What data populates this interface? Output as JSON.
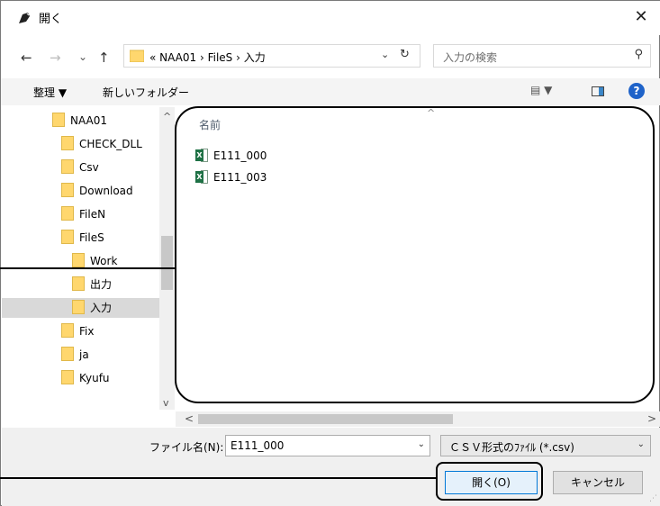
{
  "window": {
    "title": "開く",
    "close_label": "✕"
  },
  "nav": {
    "back": "←",
    "forward": "→",
    "recent": "⌄",
    "up": "↑"
  },
  "address": {
    "crumbs": "« NAA01 › FileS › 入力",
    "dropdown": "⌄",
    "refresh": "↻"
  },
  "search": {
    "placeholder": "入力の検索",
    "icon": "⚲"
  },
  "toolbar": {
    "organize_label": "整理 ▼",
    "new_folder_label": "新しいフォルダー",
    "view_label": "▤ ▼",
    "help_label": "?"
  },
  "tree": {
    "items": [
      {
        "label": "NAA01"
      },
      {
        "label": "CHECK_DLL"
      },
      {
        "label": "Csv"
      },
      {
        "label": "Download"
      },
      {
        "label": "FileN"
      },
      {
        "label": "FileS"
      },
      {
        "label": "Work"
      },
      {
        "label": "出力"
      },
      {
        "label": "入力",
        "selected": true
      },
      {
        "label": "Fix"
      },
      {
        "label": "ja"
      },
      {
        "label": "Kyufu"
      }
    ]
  },
  "file_list": {
    "column_header": "名前",
    "files": [
      {
        "name": "E111_000",
        "icon": "excel-csv-icon"
      },
      {
        "name": "E111_003",
        "icon": "excel-csv-icon"
      }
    ]
  },
  "footer": {
    "filename_label": "ファイル名(N):",
    "filename_value": "E111_000",
    "filetype_value": "ＣＳＶ形式のﾌｧｲﾙ (*.csv)",
    "open_label": "開く(O)",
    "cancel_label": "キャンセル"
  },
  "colors": {
    "accent": "#0078d7",
    "folder": "#ffd76e",
    "excel": "#1e7145",
    "help": "#1f63c9"
  }
}
